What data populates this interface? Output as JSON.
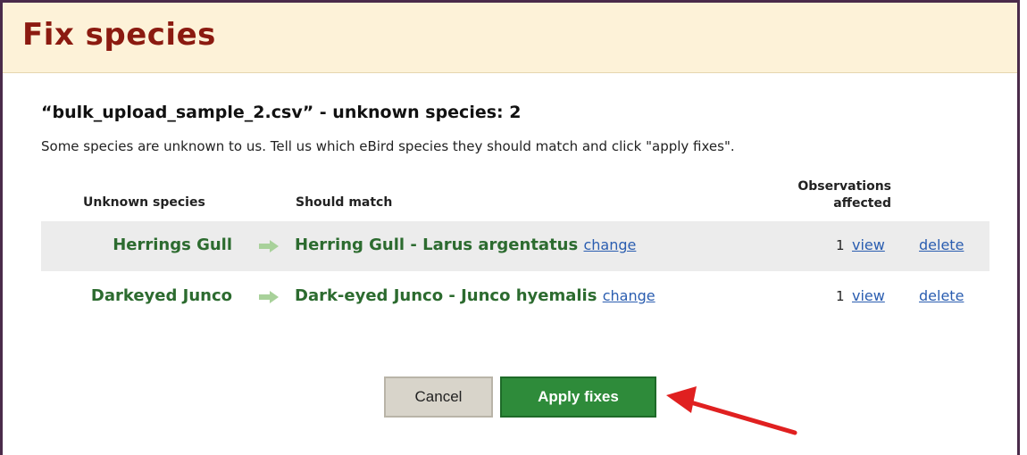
{
  "page": {
    "title": "Fix species",
    "file_heading": "“bulk_upload_sample_2.csv” - unknown species: 2",
    "instructions": "Some species are unknown to us. Tell us which eBird species they should match and click \"apply fixes\"."
  },
  "table": {
    "headers": {
      "unknown": "Unknown species",
      "match": "Should match",
      "observations_line1": "Observations",
      "observations_line2": "affected"
    },
    "rows": [
      {
        "unknown": "Herrings Gull",
        "match": "Herring Gull - Larus argentatus",
        "change": "change",
        "count": "1",
        "view": "view",
        "delete": "delete"
      },
      {
        "unknown": "Darkeyed Junco",
        "match": "Dark-eyed Junco - Junco hyemalis",
        "change": "change",
        "count": "1",
        "view": "view",
        "delete": "delete"
      }
    ]
  },
  "buttons": {
    "cancel": "Cancel",
    "apply": "Apply fixes"
  },
  "colors": {
    "title": "#8b1a10",
    "species_green": "#2c6b2f",
    "link_blue": "#2a5db0",
    "apply_button": "#2e8b3a",
    "annotation_arrow": "#e02020"
  },
  "icons": {
    "row_arrow": "right-arrow-icon",
    "annotation": "red-pointer-arrow-icon"
  }
}
